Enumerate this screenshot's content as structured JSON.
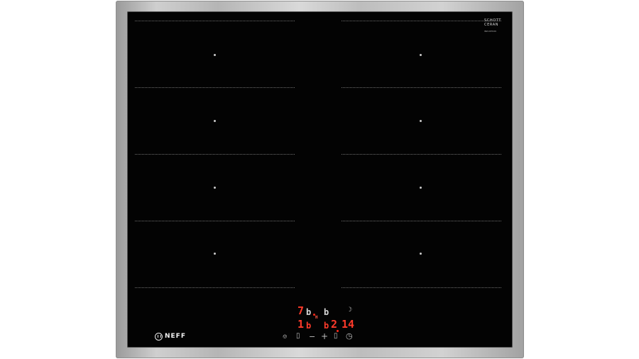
{
  "product": {
    "glass_brand_line1": "SCHOTT",
    "glass_brand_line2": "CERAN",
    "glass_sub_text": "INDUKTION",
    "logo_text": "NEFF"
  },
  "displays": {
    "top_left_digit": "7",
    "top_left_letter": "b",
    "top_right_letter": "b",
    "mid_indicator": "H",
    "bottom_left_digit": "1",
    "bottom_left_letter": "b",
    "bottom_mid_letter": "b",
    "bottom_mid_digit": "2",
    "timer_value": "14"
  },
  "controls": {
    "power_icon": "power-icon",
    "minus_label": "−",
    "plus_label": "+",
    "timer_icon": "timer-icon",
    "bell_icon": "bell-icon",
    "key_icon": "key-icon"
  },
  "colors": {
    "glass": "#030303",
    "frame": "#c4c4c4",
    "display_red": "#ff3a2a"
  }
}
